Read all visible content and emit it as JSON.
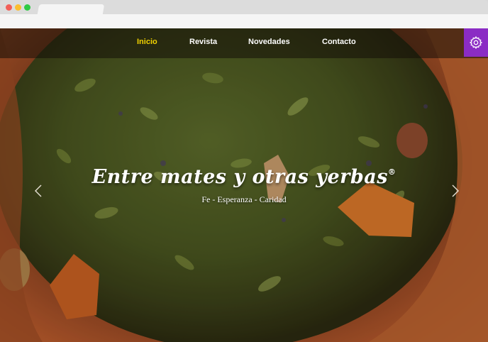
{
  "nav": {
    "items": [
      {
        "label": "Inicio",
        "active": true
      },
      {
        "label": "Revista",
        "active": false
      },
      {
        "label": "Novedades",
        "active": false
      },
      {
        "label": "Contacto",
        "active": false
      }
    ],
    "settings_icon": "gear-icon"
  },
  "hero": {
    "title": "Entre mates y otras yerbas",
    "registered_mark": "®",
    "subtitle": "Fe - Esperanza - Caridad"
  },
  "slider": {
    "prev_icon": "chevron-left-icon",
    "next_icon": "chevron-right-icon"
  },
  "colors": {
    "active_nav": "#f2d200",
    "settings_bg": "#8b2cc4"
  }
}
